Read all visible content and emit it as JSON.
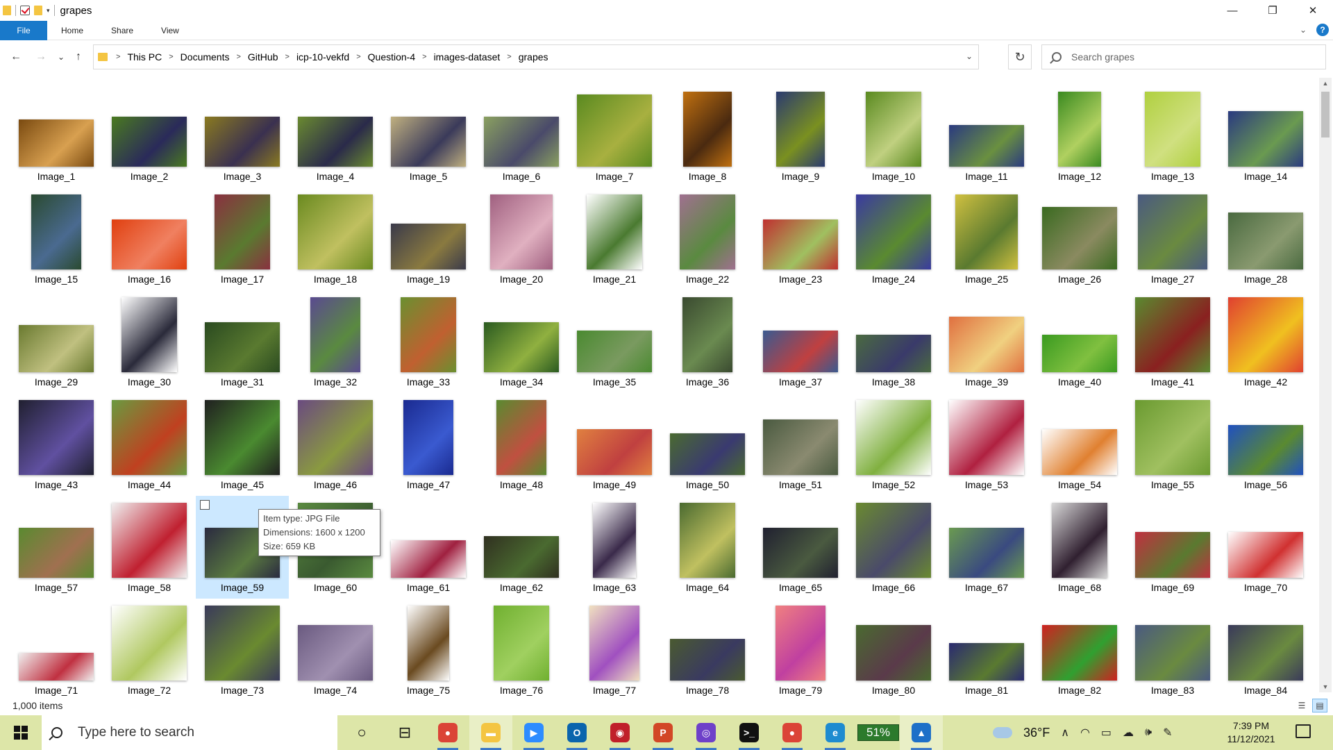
{
  "window": {
    "title": "grapes",
    "controls": {
      "minimize": "—",
      "maximize": "❐",
      "close": "✕"
    }
  },
  "ribbon": {
    "tabs": [
      "File",
      "Home",
      "Share",
      "View"
    ],
    "help": "?"
  },
  "nav": {
    "back": "←",
    "forward": "→",
    "recent": "⌄",
    "up": "↑"
  },
  "address": {
    "path": [
      "This PC",
      "Documents",
      "GitHub",
      "icp-10-vekfd",
      "Question-4",
      "images-dataset",
      "grapes"
    ],
    "refresh": "↻"
  },
  "search": {
    "placeholder": "Search grapes"
  },
  "thumbs": [
    {
      "name": "Image_1",
      "w": 108,
      "h": 68,
      "c": [
        "#7a4a10",
        "#d8a050"
      ]
    },
    {
      "name": "Image_2",
      "w": 108,
      "h": 72,
      "c": [
        "#4a7a20",
        "#2a2a5a"
      ]
    },
    {
      "name": "Image_3",
      "w": 108,
      "h": 72,
      "c": [
        "#8a7a20",
        "#3a3050"
      ]
    },
    {
      "name": "Image_4",
      "w": 108,
      "h": 72,
      "c": [
        "#6a8a30",
        "#2a2a4a"
      ]
    },
    {
      "name": "Image_5",
      "w": 108,
      "h": 72,
      "c": [
        "#c0b080",
        "#3a3a5a"
      ]
    },
    {
      "name": "Image_6",
      "w": 108,
      "h": 72,
      "c": [
        "#8aa060",
        "#4a4a6a"
      ]
    },
    {
      "name": "Image_7",
      "w": 108,
      "h": 104,
      "c": [
        "#5a8a20",
        "#a8b040"
      ]
    },
    {
      "name": "Image_8",
      "w": 70,
      "h": 108,
      "c": [
        "#c07010",
        "#4a2a10"
      ]
    },
    {
      "name": "Image_9",
      "w": 70,
      "h": 108,
      "c": [
        "#2a3a70",
        "#7a9020"
      ]
    },
    {
      "name": "Image_10",
      "w": 80,
      "h": 108,
      "c": [
        "#5a8a20",
        "#c0d080"
      ]
    },
    {
      "name": "Image_11",
      "w": 108,
      "h": 60,
      "c": [
        "#2a3a80",
        "#6a9040"
      ]
    },
    {
      "name": "Image_12",
      "w": 62,
      "h": 108,
      "c": [
        "#3a8a20",
        "#b0d060"
      ]
    },
    {
      "name": "Image_13",
      "w": 80,
      "h": 108,
      "c": [
        "#b0d040",
        "#d0e080"
      ]
    },
    {
      "name": "Image_14",
      "w": 108,
      "h": 80,
      "c": [
        "#2a3a80",
        "#6a9a50"
      ]
    },
    {
      "name": "Image_15",
      "w": 72,
      "h": 108,
      "c": [
        "#2a4a30",
        "#4a6a90"
      ]
    },
    {
      "name": "Image_16",
      "w": 108,
      "h": 72,
      "c": [
        "#e04010",
        "#f08060"
      ]
    },
    {
      "name": "Image_17",
      "w": 80,
      "h": 108,
      "c": [
        "#8a3040",
        "#5a7a30"
      ]
    },
    {
      "name": "Image_18",
      "w": 108,
      "h": 108,
      "c": [
        "#6a8a20",
        "#c0c060"
      ]
    },
    {
      "name": "Image_19",
      "w": 108,
      "h": 66,
      "c": [
        "#3a3a4a",
        "#8a7a40"
      ]
    },
    {
      "name": "Image_20",
      "w": 90,
      "h": 108,
      "c": [
        "#a06080",
        "#e0b0c0"
      ]
    },
    {
      "name": "Image_21",
      "w": 80,
      "h": 108,
      "c": [
        "#ffffff",
        "#4a7a30"
      ]
    },
    {
      "name": "Image_22",
      "w": 80,
      "h": 108,
      "c": [
        "#a07090",
        "#5a8a40"
      ]
    },
    {
      "name": "Image_23",
      "w": 108,
      "h": 72,
      "c": [
        "#c03030",
        "#a0c060"
      ]
    },
    {
      "name": "Image_24",
      "w": 108,
      "h": 108,
      "c": [
        "#3a3aa0",
        "#5a8a30"
      ]
    },
    {
      "name": "Image_25",
      "w": 90,
      "h": 108,
      "c": [
        "#d0c040",
        "#5a7a30"
      ]
    },
    {
      "name": "Image_26",
      "w": 108,
      "h": 90,
      "c": [
        "#3a6a20",
        "#8a8a60"
      ]
    },
    {
      "name": "Image_27",
      "w": 100,
      "h": 108,
      "c": [
        "#4a5a80",
        "#6a8a40"
      ]
    },
    {
      "name": "Image_28",
      "w": 108,
      "h": 82,
      "c": [
        "#4a6a40",
        "#8a9a70"
      ]
    },
    {
      "name": "Image_29",
      "w": 108,
      "h": 68,
      "c": [
        "#6a7a30",
        "#c0c080"
      ]
    },
    {
      "name": "Image_30",
      "w": 80,
      "h": 108,
      "c": [
        "#ffffff",
        "#2a2a3a"
      ]
    },
    {
      "name": "Image_31",
      "w": 108,
      "h": 72,
      "c": [
        "#2a4a20",
        "#5a7a30"
      ]
    },
    {
      "name": "Image_32",
      "w": 72,
      "h": 108,
      "c": [
        "#5a4a90",
        "#5a8a40"
      ]
    },
    {
      "name": "Image_33",
      "w": 80,
      "h": 108,
      "c": [
        "#6a9030",
        "#c06030"
      ]
    },
    {
      "name": "Image_34",
      "w": 108,
      "h": 72,
      "c": [
        "#2a5a20",
        "#90b040"
      ]
    },
    {
      "name": "Image_35",
      "w": 108,
      "h": 60,
      "c": [
        "#4a8a30",
        "#7a9a60"
      ]
    },
    {
      "name": "Image_36",
      "w": 72,
      "h": 108,
      "c": [
        "#3a4a30",
        "#6a8a50"
      ]
    },
    {
      "name": "Image_37",
      "w": 108,
      "h": 60,
      "c": [
        "#3a5a90",
        "#c04040"
      ]
    },
    {
      "name": "Image_38",
      "w": 108,
      "h": 54,
      "c": [
        "#4a6a40",
        "#3a3a6a"
      ]
    },
    {
      "name": "Image_39",
      "w": 108,
      "h": 80,
      "c": [
        "#e07040",
        "#f0d080"
      ]
    },
    {
      "name": "Image_40",
      "w": 108,
      "h": 54,
      "c": [
        "#3a9a20",
        "#80c040"
      ]
    },
    {
      "name": "Image_41",
      "w": 108,
      "h": 108,
      "c": [
        "#5a8a30",
        "#8a2020"
      ]
    },
    {
      "name": "Image_42",
      "w": 108,
      "h": 108,
      "c": [
        "#e04030",
        "#f0c020"
      ]
    },
    {
      "name": "Image_43",
      "w": 108,
      "h": 108,
      "c": [
        "#202030",
        "#6050a0"
      ]
    },
    {
      "name": "Image_44",
      "w": 108,
      "h": 108,
      "c": [
        "#6a9a40",
        "#c04020"
      ]
    },
    {
      "name": "Image_45",
      "w": 108,
      "h": 108,
      "c": [
        "#202020",
        "#4a8a30"
      ]
    },
    {
      "name": "Image_46",
      "w": 108,
      "h": 108,
      "c": [
        "#6a4a80",
        "#8a9a40"
      ]
    },
    {
      "name": "Image_47",
      "w": 72,
      "h": 108,
      "c": [
        "#1a2a90",
        "#3a5ad0"
      ]
    },
    {
      "name": "Image_48",
      "w": 72,
      "h": 108,
      "c": [
        "#5a8a30",
        "#c05040"
      ]
    },
    {
      "name": "Image_49",
      "w": 108,
      "h": 66,
      "c": [
        "#e08040",
        "#c04040"
      ]
    },
    {
      "name": "Image_50",
      "w": 108,
      "h": 60,
      "c": [
        "#4a6a30",
        "#3a3a70"
      ]
    },
    {
      "name": "Image_51",
      "w": 108,
      "h": 80,
      "c": [
        "#4a5a40",
        "#8a8a70"
      ]
    },
    {
      "name": "Image_52",
      "w": 108,
      "h": 108,
      "c": [
        "#ffffff",
        "#80b040"
      ]
    },
    {
      "name": "Image_53",
      "w": 108,
      "h": 108,
      "c": [
        "#ffffff",
        "#b02040"
      ]
    },
    {
      "name": "Image_54",
      "w": 108,
      "h": 66,
      "c": [
        "#ffffff",
        "#e08030"
      ]
    },
    {
      "name": "Image_55",
      "w": 108,
      "h": 108,
      "c": [
        "#6a9a30",
        "#a0c060"
      ]
    },
    {
      "name": "Image_56",
      "w": 108,
      "h": 72,
      "c": [
        "#2050c0",
        "#5a8a30"
      ]
    },
    {
      "name": "Image_57",
      "w": 108,
      "h": 72,
      "c": [
        "#5a8a30",
        "#a07050"
      ]
    },
    {
      "name": "Image_58",
      "w": 108,
      "h": 108,
      "c": [
        "#f0f0f0",
        "#c02030"
      ]
    },
    {
      "name": "Image_59",
      "w": 108,
      "h": 72,
      "c": [
        "#2a2a40",
        "#5a7a40"
      ]
    },
    {
      "name": "Image_60",
      "w": 108,
      "h": 108,
      "c": [
        "#5a8a40",
        "#3a5a30"
      ]
    },
    {
      "name": "Image_61",
      "w": 108,
      "h": 54,
      "c": [
        "#ffffff",
        "#a02040"
      ]
    },
    {
      "name": "Image_62",
      "w": 108,
      "h": 60,
      "c": [
        "#303020",
        "#4a6a30"
      ]
    },
    {
      "name": "Image_63",
      "w": 62,
      "h": 108,
      "c": [
        "#ffffff",
        "#3a2a4a"
      ]
    },
    {
      "name": "Image_64",
      "w": 80,
      "h": 108,
      "c": [
        "#4a6a30",
        "#c0c060"
      ]
    },
    {
      "name": "Image_65",
      "w": 108,
      "h": 72,
      "c": [
        "#202030",
        "#4a5a40"
      ]
    },
    {
      "name": "Image_66",
      "w": 108,
      "h": 108,
      "c": [
        "#6a8a30",
        "#4a4a6a"
      ]
    },
    {
      "name": "Image_67",
      "w": 108,
      "h": 72,
      "c": [
        "#6a9a50",
        "#3a4a80"
      ]
    },
    {
      "name": "Image_68",
      "w": 80,
      "h": 108,
      "c": [
        "#d8d8d8",
        "#302030"
      ]
    },
    {
      "name": "Image_69",
      "w": 108,
      "h": 66,
      "c": [
        "#c03040",
        "#5a7a30"
      ]
    },
    {
      "name": "Image_70",
      "w": 108,
      "h": 66,
      "c": [
        "#ffffff",
        "#d03030"
      ]
    },
    {
      "name": "Image_71",
      "w": 108,
      "h": 40,
      "c": [
        "#f0f0f0",
        "#c03040"
      ]
    },
    {
      "name": "Image_72",
      "w": 108,
      "h": 108,
      "c": [
        "#ffffff",
        "#b0c860"
      ]
    },
    {
      "name": "Image_73",
      "w": 108,
      "h": 108,
      "c": [
        "#3a3a5a",
        "#6a8a30"
      ]
    },
    {
      "name": "Image_74",
      "w": 108,
      "h": 80,
      "c": [
        "#6a5a80",
        "#a090b0"
      ]
    },
    {
      "name": "Image_75",
      "w": 60,
      "h": 108,
      "c": [
        "#ffffff",
        "#6a4a20"
      ]
    },
    {
      "name": "Image_76",
      "w": 80,
      "h": 108,
      "c": [
        "#70b030",
        "#a0d060"
      ]
    },
    {
      "name": "Image_77",
      "w": 72,
      "h": 108,
      "c": [
        "#f0e0c0",
        "#a050c0"
      ]
    },
    {
      "name": "Image_78",
      "w": 108,
      "h": 60,
      "c": [
        "#4a5a30",
        "#3a3a60"
      ]
    },
    {
      "name": "Image_79",
      "w": 72,
      "h": 108,
      "c": [
        "#f08080",
        "#c040a0"
      ]
    },
    {
      "name": "Image_80",
      "w": 108,
      "h": 80,
      "c": [
        "#4a6a30",
        "#5a3a4a"
      ]
    },
    {
      "name": "Image_81",
      "w": 108,
      "h": 54,
      "c": [
        "#2a2a70",
        "#5a7a30"
      ]
    },
    {
      "name": "Image_82",
      "w": 108,
      "h": 80,
      "c": [
        "#d02020",
        "#30a030"
      ]
    },
    {
      "name": "Image_83",
      "w": 108,
      "h": 80,
      "c": [
        "#4a5a80",
        "#6a8a40"
      ]
    },
    {
      "name": "Image_84",
      "w": 108,
      "h": 80,
      "c": [
        "#3a3a5a",
        "#6a8a40"
      ]
    }
  ],
  "selection": {
    "selected_index": 58,
    "hover_index": 59
  },
  "tooltip": {
    "type": "Item type: JPG File",
    "dimensions": "Dimensions: 1600 x 1200",
    "size": "Size: 659 KB"
  },
  "status": {
    "count": "1,000 items"
  },
  "taskbar": {
    "search_placeholder": "Type here to search",
    "apps": [
      {
        "name": "cortana-icon",
        "glyph": "○",
        "bg": "transparent",
        "fg": "#111"
      },
      {
        "name": "task-view-icon",
        "glyph": "⊟",
        "bg": "transparent",
        "fg": "#111"
      },
      {
        "name": "chrome-icon",
        "glyph": "●",
        "bg": "#db4437",
        "fg": "#fff",
        "running": true
      },
      {
        "name": "file-explorer-icon",
        "glyph": "▬",
        "bg": "#f4c542",
        "fg": "#fff",
        "running": true,
        "active": true
      },
      {
        "name": "zoom-icon",
        "glyph": "▶",
        "bg": "#2d8cff",
        "fg": "#fff",
        "running": true
      },
      {
        "name": "outlook-icon",
        "glyph": "O",
        "bg": "#0a64ad",
        "fg": "#fff",
        "running": true
      },
      {
        "name": "screen-recorder-icon",
        "glyph": "◉",
        "bg": "#c0202a",
        "fg": "#fff",
        "running": true
      },
      {
        "name": "powerpoint-icon",
        "glyph": "P",
        "bg": "#d24726",
        "fg": "#fff",
        "running": true
      },
      {
        "name": "github-icon",
        "glyph": "◎",
        "bg": "#6e40c9",
        "fg": "#fff",
        "running": true
      },
      {
        "name": "terminal-icon",
        "glyph": ">_",
        "bg": "#111",
        "fg": "#fff",
        "running": true
      },
      {
        "name": "chrome-profile-icon",
        "glyph": "●",
        "bg": "#db4437",
        "fg": "#fff",
        "running": true
      },
      {
        "name": "edge-icon",
        "glyph": "e",
        "bg": "#1e8bd0",
        "fg": "#fff",
        "running": true
      },
      {
        "name": "photos-icon",
        "glyph": "▲",
        "bg": "#1e70c8",
        "fg": "#fff",
        "running": true,
        "active": true
      }
    ],
    "battery_widget": "51%",
    "weather": "36°F",
    "time": "7:39 PM",
    "date": "11/12/2021"
  }
}
